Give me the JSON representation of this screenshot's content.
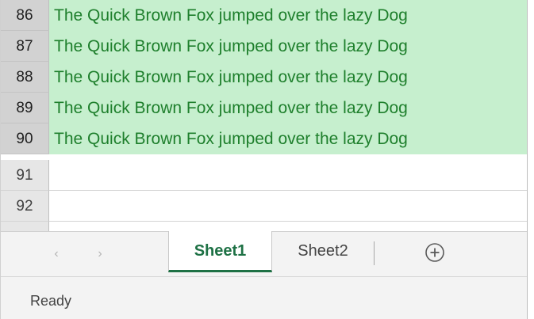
{
  "rows": [
    {
      "number": "86",
      "text": "The Quick Brown Fox jumped over the lazy Dog"
    },
    {
      "number": "87",
      "text": "The Quick Brown Fox jumped over the lazy Dog"
    },
    {
      "number": "88",
      "text": "The Quick Brown Fox jumped over the lazy Dog"
    },
    {
      "number": "89",
      "text": "The Quick Brown Fox jumped over the lazy Dog"
    },
    {
      "number": "90",
      "text": "The Quick Brown Fox jumped over the lazy Dog"
    },
    {
      "number": "91",
      "text": ""
    },
    {
      "number": "92",
      "text": ""
    }
  ],
  "sheet_nav": {
    "prev_icon": "‹",
    "next_icon": "›"
  },
  "tabs": [
    {
      "label": "Sheet1",
      "active": true
    },
    {
      "label": "Sheet2",
      "active": false
    }
  ],
  "add_sheet_icon": "plus-circle-icon",
  "status": {
    "text": "Ready"
  },
  "colors": {
    "highlight_fill": "#c6efce",
    "highlight_text": "#1e7f2c",
    "active_tab_accent": "#1e7145"
  }
}
